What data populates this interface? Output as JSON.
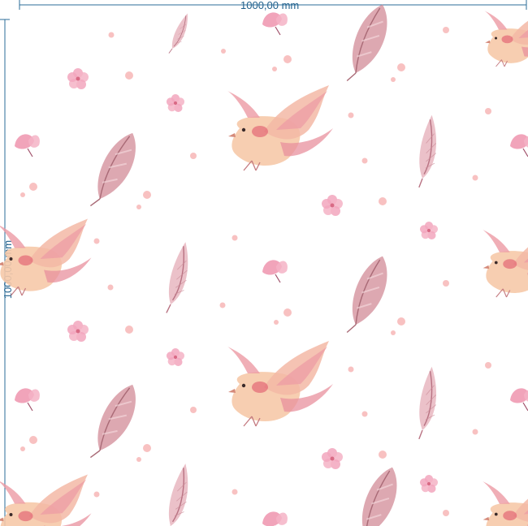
{
  "dimensions": {
    "width_label": "1000,00 mm",
    "height_label": "1000,00 mm"
  },
  "pattern": {
    "motifs": [
      "bird",
      "feather",
      "blossom",
      "dot"
    ],
    "colors": {
      "dimension_line": "#2b6c99",
      "bird_body": "#f6c9a8",
      "bird_wing": "#ec9aa4",
      "bird_accent": "#e0566a",
      "feather": "#c98a96",
      "blossom": "#f2a6bd",
      "dot": "#f7b7b7"
    }
  }
}
